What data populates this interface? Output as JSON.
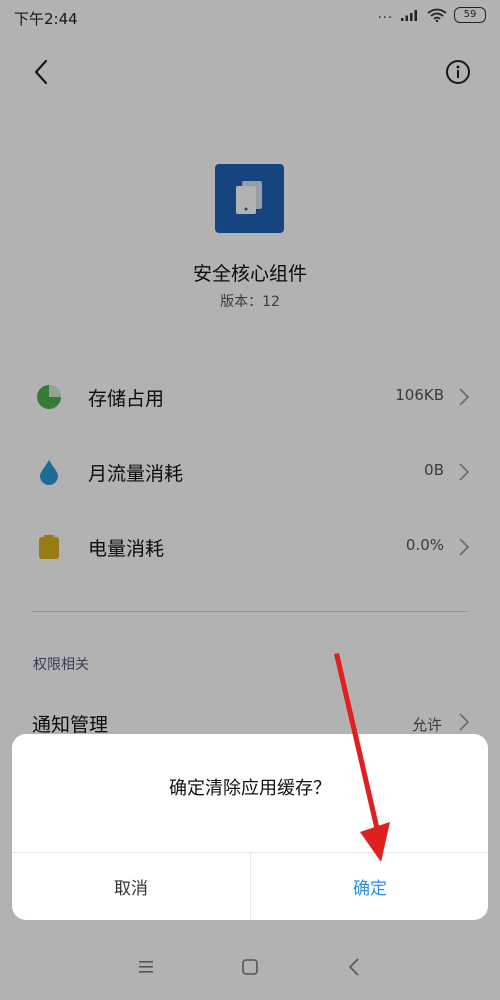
{
  "status_bar": {
    "time": "下午2:44",
    "dots": "...",
    "battery_level": "59",
    "icons": [
      "cellular-signal-icon",
      "wifi-icon",
      "battery-icon"
    ]
  },
  "header": {
    "back_icon": "chevron-left-icon",
    "info_icon": "info-icon"
  },
  "app": {
    "icon": "app-tablet-icon",
    "name": "安全核心组件",
    "version": "版本：12",
    "icon_color": "#1f63b5"
  },
  "rows": [
    {
      "label": "存储占用",
      "value": "106KB",
      "icon": "pie-chart-icon",
      "icon_color": "#4caf50"
    },
    {
      "label": "月流量消耗",
      "value": "0B",
      "icon": "water-drop-icon",
      "icon_color": "#2b9ad8"
    },
    {
      "label": "电量消耗",
      "value": "0.0%",
      "icon": "battery-level-icon",
      "icon_color": "#d9b21a"
    }
  ],
  "permissions": {
    "section_label": "权限相关",
    "notification_label": "通知管理",
    "notification_value": "允许"
  },
  "dialog": {
    "message": "确定清除应用缓存？",
    "cancel_label": "取消",
    "confirm_label": "确定",
    "confirm_color": "#2a8ee8"
  },
  "annotation": {
    "arrow_color": "#e02020"
  },
  "nav": {
    "items": [
      "menu-icon",
      "home-square-icon",
      "back-triangle-icon"
    ]
  }
}
